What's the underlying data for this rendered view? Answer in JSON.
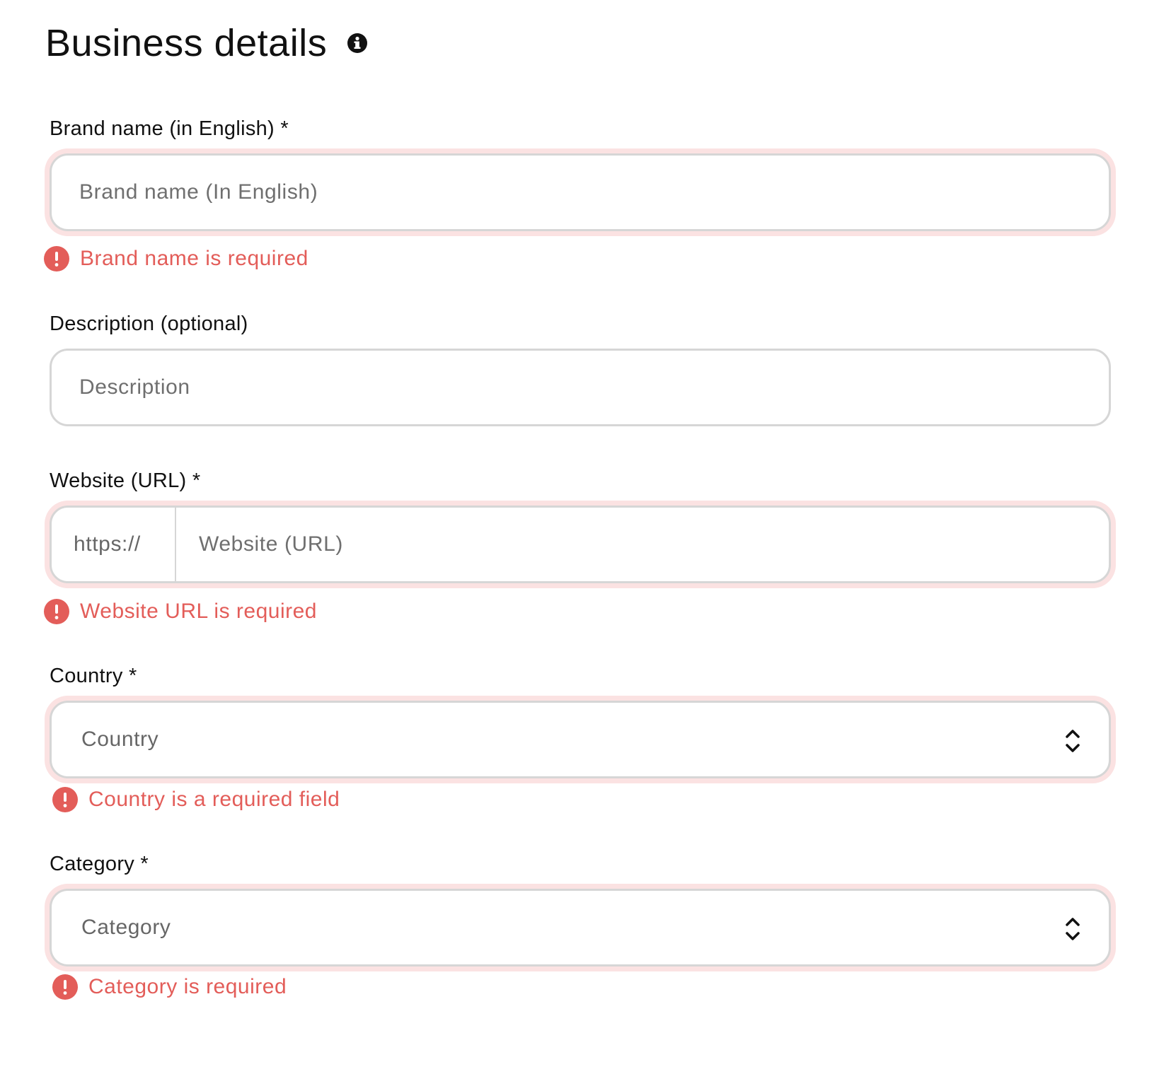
{
  "header": {
    "title": "Business details",
    "info_icon": "info-icon"
  },
  "colors": {
    "error": "#e35d59",
    "error_glow": "#fbe2e2",
    "border": "#d6d6d6",
    "placeholder": "#6f6f6f"
  },
  "form": {
    "brand_name": {
      "label": "Brand name (in English) *",
      "placeholder": "Brand name (In English)",
      "value": "",
      "error": "Brand name is required"
    },
    "description": {
      "label": "Description (optional)",
      "placeholder": "Description",
      "value": ""
    },
    "website": {
      "label": "Website (URL) *",
      "prefix": "https://",
      "placeholder": "Website (URL)",
      "value": "",
      "error": "Website URL is required"
    },
    "country": {
      "label": "Country *",
      "selected": "Country",
      "icon": "chevron-up-down-icon",
      "error": "Country is a required field"
    },
    "category": {
      "label": "Category *",
      "selected": "Category",
      "icon": "chevron-up-down-icon",
      "error": "Category is required"
    }
  }
}
